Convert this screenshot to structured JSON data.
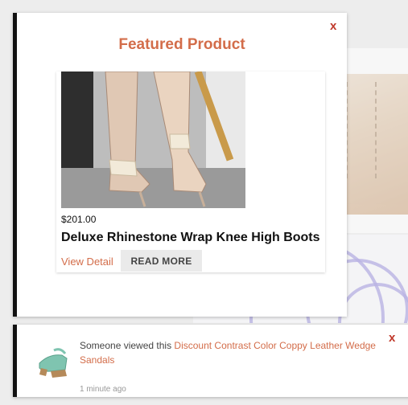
{
  "popup": {
    "title": "Featured Product",
    "close_label": "x",
    "product": {
      "price": "$201.00",
      "name": "Deluxe Rhinestone Wrap Knee High Boots",
      "view_detail_label": "View Detail",
      "read_more_label": "READ MORE",
      "image_icon": "boots-photo"
    }
  },
  "notification": {
    "prefix": "Someone viewed this ",
    "product_link": "Discount Contrast Color Coppy Leather Wedge Sandals",
    "time": "1 minute ago",
    "close_label": "x",
    "image_icon": "sandal-photo"
  },
  "colors": {
    "accent": "#d36d4a",
    "close": "#c0392b",
    "border": "#111111"
  }
}
